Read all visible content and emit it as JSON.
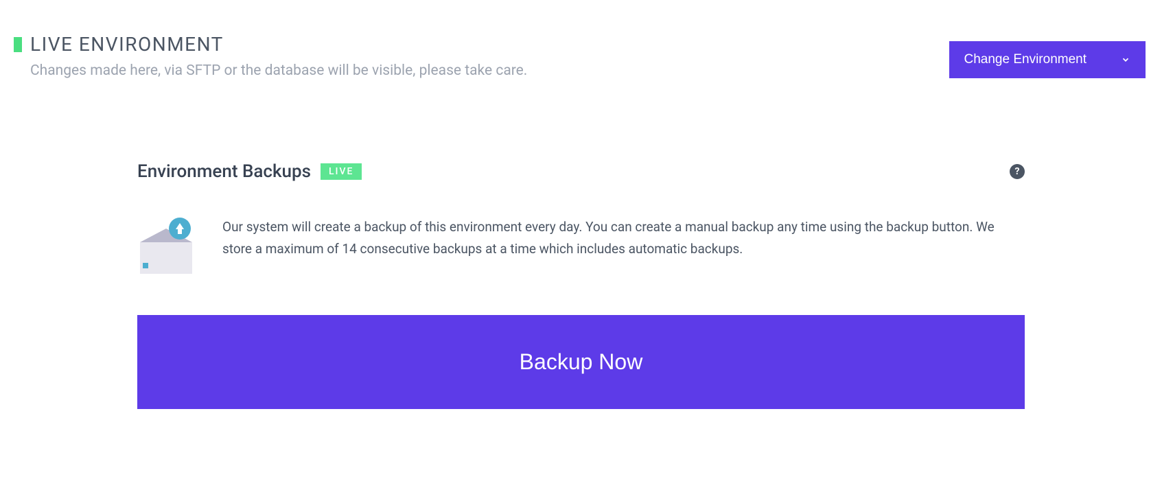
{
  "header": {
    "title": "LIVE ENVIRONMENT",
    "subtitle": "Changes made here, via SFTP or the database will be visible, please take care.",
    "change_env_label": "Change Environment"
  },
  "section": {
    "title": "Environment Backups",
    "badge": "LIVE",
    "help_symbol": "?",
    "info_text": "Our system will create a backup of this environment every day. You can create a manual backup any time using the backup button. We store a maximum of 14 consecutive backups at a time which includes automatic backups.",
    "backup_now_label": "Backup Now"
  },
  "colors": {
    "accent": "#5d3be8",
    "live_green": "#5de592",
    "indicator_green": "#4ade80"
  }
}
